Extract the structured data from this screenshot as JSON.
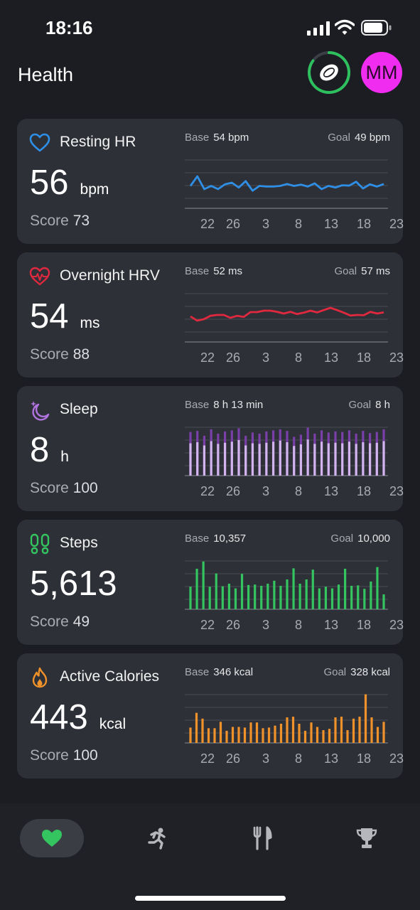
{
  "status_bar": {
    "time": "18:16"
  },
  "header": {
    "title": "Health",
    "avatar_initials": "MM"
  },
  "x_ticks": [
    "22",
    "26",
    "3",
    "8",
    "13",
    "18",
    "23"
  ],
  "cards": [
    {
      "title": "Resting HR",
      "value": "56",
      "unit": "bpm",
      "score_label": "Score",
      "score": "73",
      "base_label": "Base",
      "base": "54 bpm",
      "goal_label": "Goal",
      "goal": "49 bpm",
      "color": "#2f8fe6",
      "icon": "heart-outline-icon",
      "chart_data": {
        "type": "line",
        "values": [
          57,
          60,
          56,
          57,
          56,
          57.5,
          58,
          56.5,
          58.5,
          55.5,
          57,
          56.8,
          56.8,
          57,
          57.6,
          57,
          57.4,
          56.8,
          57.8,
          56,
          57,
          56.5,
          57.2,
          57.1,
          58.3,
          56.2,
          57.5,
          56.8,
          57.6
        ],
        "ylim": [
          50,
          66
        ]
      }
    },
    {
      "title": "Overnight HRV",
      "value": "54",
      "unit": "ms",
      "score_label": "Score",
      "score": "88",
      "base_label": "Base",
      "base": "52 ms",
      "goal_label": "Goal",
      "goal": "57 ms",
      "color": "#e0283e",
      "icon": "heartbeat-icon",
      "chart_data": {
        "type": "line",
        "values": [
          53,
          51.5,
          52,
          53.2,
          53.5,
          53.5,
          52.5,
          53.2,
          52.8,
          54.5,
          54.5,
          55,
          55,
          54.6,
          54,
          54.6,
          53.8,
          54.3,
          55,
          54.4,
          55.2,
          56,
          55.2,
          54.3,
          53.3,
          53.5,
          53.4,
          54.6,
          54,
          54.4
        ],
        "ylim": [
          44,
          62
        ]
      }
    },
    {
      "title": "Sleep",
      "value": "8",
      "unit": "h",
      "score_label": "Score",
      "score": "100",
      "base_label": "Base",
      "base": "8 h 13 min",
      "goal_label": "Goal",
      "goal": "8 h",
      "color": "#b174e0",
      "icon": "moon-stars-icon",
      "chart_data": {
        "type": "bar",
        "series": [
          {
            "values": [
              8.1,
              8.3,
              7.4,
              8.6,
              7.8,
              8.2,
              8.4,
              8.8,
              7.4,
              8.0,
              7.8,
              8.2,
              8.4,
              8.6,
              8.3,
              7.2,
              7.6,
              8.9,
              7.8,
              8.4,
              8.0,
              8.2,
              8.1,
              8.4,
              7.8,
              8.3,
              7.9,
              8.1,
              8.6
            ]
          },
          {
            "values": [
              6.0,
              6.2,
              5.6,
              6.4,
              5.9,
              6.1,
              6.3,
              6.6,
              5.6,
              6.0,
              5.9,
              6.1,
              6.3,
              6.5,
              6.2,
              5.5,
              5.8,
              6.7,
              5.9,
              6.3,
              6.0,
              6.1,
              6.0,
              6.3,
              5.9,
              6.2,
              6.0,
              6.1,
              6.4
            ]
          }
        ],
        "ylim": [
          0,
          9.5
        ]
      }
    },
    {
      "title": "Steps",
      "value": "5,613",
      "unit": "",
      "score_label": "Score",
      "score": "49",
      "base_label": "Base",
      "base": "10,357",
      "goal_label": "Goal",
      "goal": "10,000",
      "color": "#34c460",
      "icon": "footprints-icon",
      "chart_data": {
        "type": "bar",
        "values": [
          5300,
          9500,
          11200,
          5300,
          8400,
          5400,
          6000,
          4900,
          8300,
          5700,
          5800,
          5500,
          6000,
          6700,
          5500,
          7000,
          9600,
          6000,
          7000,
          9300,
          4900,
          5300,
          4900,
          5800,
          9500,
          5500,
          5600,
          4800,
          6500,
          9900,
          3500
        ],
        "ylim": [
          0,
          12000
        ]
      }
    },
    {
      "title": "Active Calories",
      "value": "443",
      "unit": "kcal",
      "score_label": "Score",
      "score": "100",
      "base_label": "Base",
      "base": "346 kcal",
      "goal_label": "Goal",
      "goal": "328 kcal",
      "color": "#f0922a",
      "icon": "flame-icon",
      "chart_data": {
        "type": "bar",
        "values": [
          240,
          470,
          380,
          230,
          230,
          330,
          190,
          250,
          250,
          240,
          320,
          320,
          230,
          240,
          270,
          300,
          400,
          410,
          300,
          190,
          320,
          250,
          200,
          220,
          400,
          410,
          200,
          380,
          410,
          760,
          400,
          250,
          330
        ],
        "ylim": [
          0,
          800
        ]
      }
    }
  ],
  "tab_bar": {
    "tabs": [
      {
        "name": "tab-health",
        "icon": "heart-icon",
        "active": true
      },
      {
        "name": "tab-activity",
        "icon": "running-icon",
        "active": false
      },
      {
        "name": "tab-nutrition",
        "icon": "fork-knife-icon",
        "active": false
      },
      {
        "name": "tab-challenges",
        "icon": "trophy-icon",
        "active": false
      }
    ],
    "active_color": "#34c460"
  }
}
